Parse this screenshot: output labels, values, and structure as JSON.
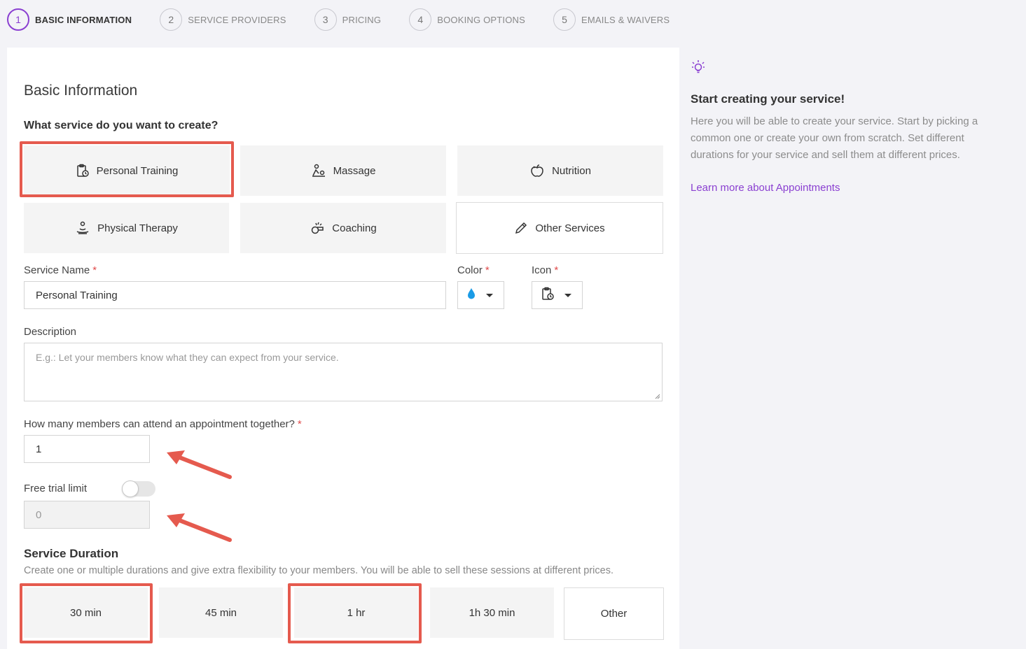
{
  "stepper": {
    "steps": [
      {
        "num": "1",
        "label": "BASIC INFORMATION"
      },
      {
        "num": "2",
        "label": "SERVICE PROVIDERS"
      },
      {
        "num": "3",
        "label": "PRICING"
      },
      {
        "num": "4",
        "label": "BOOKING OPTIONS"
      },
      {
        "num": "5",
        "label": "EMAILS & WAIVERS"
      }
    ]
  },
  "form": {
    "title": "Basic Information",
    "question": "What service do you want to create?",
    "service_types": [
      {
        "label": "Personal Training",
        "icon": "clipboard-clock-icon"
      },
      {
        "label": "Massage",
        "icon": "massage-icon"
      },
      {
        "label": "Nutrition",
        "icon": "apple-icon"
      },
      {
        "label": "Physical Therapy",
        "icon": "therapy-icon"
      },
      {
        "label": "Coaching",
        "icon": "whistle-icon"
      },
      {
        "label": "Other Services",
        "icon": "pencil-icon"
      }
    ],
    "service_name": {
      "label": "Service Name",
      "value": "Personal Training"
    },
    "color": {
      "label": "Color",
      "value_color": "#1a9be6"
    },
    "icon_field": {
      "label": "Icon"
    },
    "description": {
      "label": "Description",
      "placeholder": "E.g.: Let your members know what they can expect from your service."
    },
    "members": {
      "label": "How many members can attend an appointment together?",
      "value": "1"
    },
    "free_trial": {
      "label": "Free trial limit",
      "value": "0",
      "enabled": false
    },
    "duration": {
      "title": "Service Duration",
      "subtitle": "Create one or multiple durations and give extra flexibility to your members. You will be able to sell these sessions at different prices.",
      "options": [
        "30 min",
        "45 min",
        "1 hr",
        "1h 30 min",
        "Other"
      ]
    },
    "required_mark": "*"
  },
  "tips": {
    "icon": "lightbulb-icon",
    "title": "Start creating your service!",
    "text": "Here you will be able to create your service. Start by picking a common one or create your own from scratch. Set different durations for your service and sell them at different prices.",
    "link": "Learn more about Appointments"
  },
  "colors": {
    "accent": "#8a3fd1",
    "highlight": "#e55a4e"
  }
}
